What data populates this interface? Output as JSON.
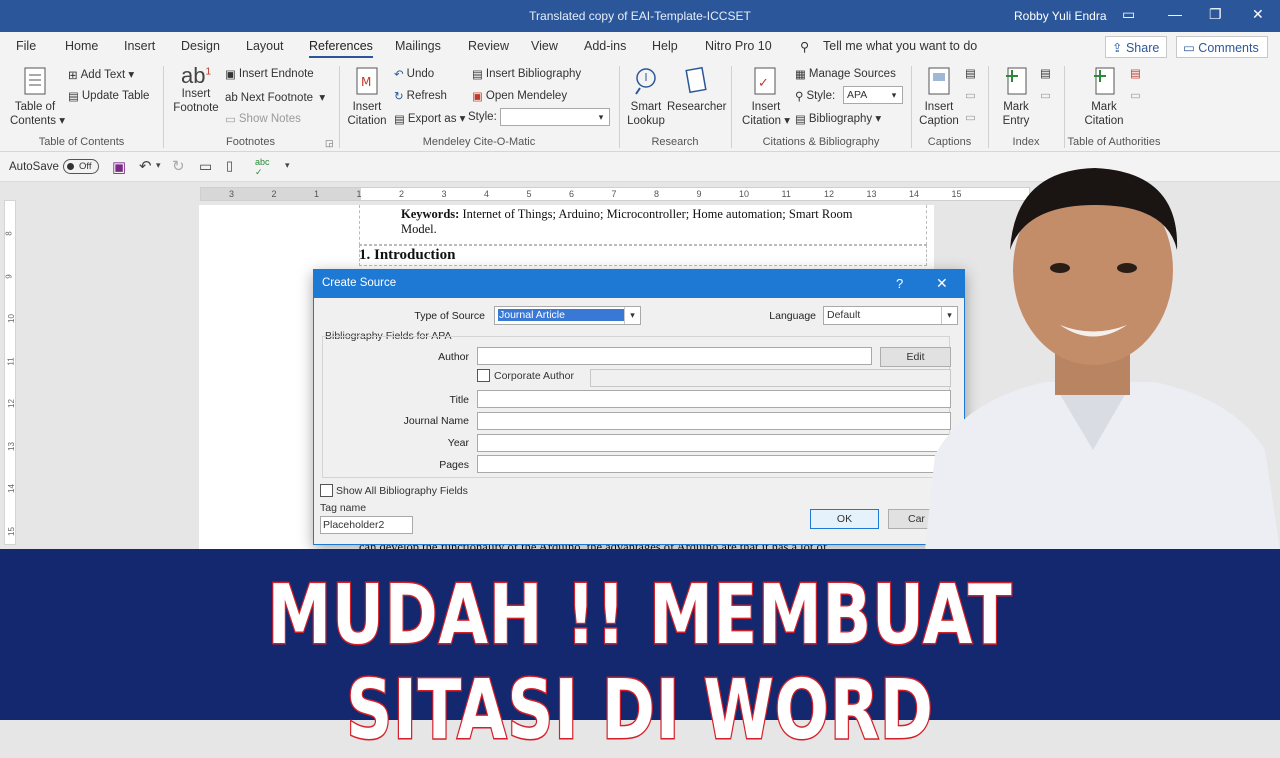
{
  "window": {
    "title": "Translated copy of EAI-Template-ICCSET",
    "user": "Robby Yuli Endra"
  },
  "menu": {
    "items": [
      "File",
      "Home",
      "Insert",
      "Design",
      "Layout",
      "References",
      "Mailings",
      "Review",
      "View",
      "Add-ins",
      "Help",
      "Nitro Pro 10"
    ],
    "active": "References",
    "tell_me": "Tell me what you want to do",
    "share": "Share",
    "comments": "Comments"
  },
  "ribbon": {
    "toc": {
      "table_of_contents": "Table of",
      "table_of_contents2": "Contents",
      "add_text": "Add Text",
      "update_table": "Update Table",
      "group": "Table of Contents"
    },
    "footnotes": {
      "insert_footnote": "Insert",
      "insert_footnote2": "Footnote",
      "insert_endnote": "Insert Endnote",
      "next_footnote": "Next Footnote",
      "show_notes": "Show Notes",
      "group": "Footnotes"
    },
    "mendeley": {
      "insert_citation": "Insert",
      "insert_citation2": "Citation",
      "undo": "Undo",
      "refresh": "Refresh",
      "export_as": "Export as",
      "insert_bibliography": "Insert Bibliography",
      "open_mendeley": "Open Mendeley",
      "style_label": "Style:",
      "group": "Mendeley Cite-O-Matic"
    },
    "research": {
      "smart_lookup": "Smart",
      "smart_lookup2": "Lookup",
      "researcher": "Researcher",
      "group": "Research"
    },
    "citations": {
      "insert_citation": "Insert",
      "insert_citation2": "Citation",
      "manage_sources": "Manage Sources",
      "style_label": "Style:",
      "style_value": "APA",
      "bibliography": "Bibliography",
      "group": "Citations & Bibliography"
    },
    "captions": {
      "insert_caption": "Insert",
      "insert_caption2": "Caption",
      "group": "Captions"
    },
    "index": {
      "mark_entry": "Mark",
      "mark_entry2": "Entry",
      "group": "Index"
    },
    "authorities": {
      "mark_citation": "Mark",
      "mark_citation2": "Citation",
      "group": "Table of Authorities"
    }
  },
  "qat": {
    "autosave": "AutoSave",
    "toggle": "Off"
  },
  "ruler": {
    "ticks": [
      "3",
      "2",
      "1",
      "1",
      "2",
      "3",
      "4",
      "5",
      "6",
      "7",
      "8",
      "9",
      "10",
      "11",
      "12",
      "13",
      "14",
      "15"
    ]
  },
  "vruler": {
    "ticks": [
      "8",
      "9",
      "10",
      "11",
      "12",
      "13",
      "14",
      "15",
      "16"
    ]
  },
  "document": {
    "keywords_label": "Keywords:",
    "keywords_text": "Internet of Things; Arduino; Microcontroller; Home automation; Smart Room",
    "keywords_text2": "Model.",
    "heading": "1.  Introduction",
    "body_partial": "can develop the functionality of the Arduino, the advantages of Arduino are that it has a lot of"
  },
  "dialog": {
    "title": "Create Source",
    "help": "?",
    "type_label": "Type of Source",
    "type_value": "Journal Article",
    "language_label": "Language",
    "language_value": "Default",
    "section": "Bibliography Fields for APA",
    "author_label": "Author",
    "edit_button": "Edit",
    "corporate_author": "Corporate Author",
    "title_label": "Title",
    "journal_label": "Journal Name",
    "year_label": "Year",
    "pages_label": "Pages",
    "show_all": "Show All Bibliography Fields",
    "tag_label": "Tag name",
    "tag_value": "Placeholder2",
    "ok": "OK",
    "cancel": "Car"
  },
  "banner": {
    "text": "MUDAH !! MEMBUAT SITASI DI WORD"
  },
  "colors": {
    "accent": "#2b579a",
    "dialog_accent": "#1e79d4",
    "banner_bg": "#13286e",
    "banner_stroke": "#d4212a"
  }
}
